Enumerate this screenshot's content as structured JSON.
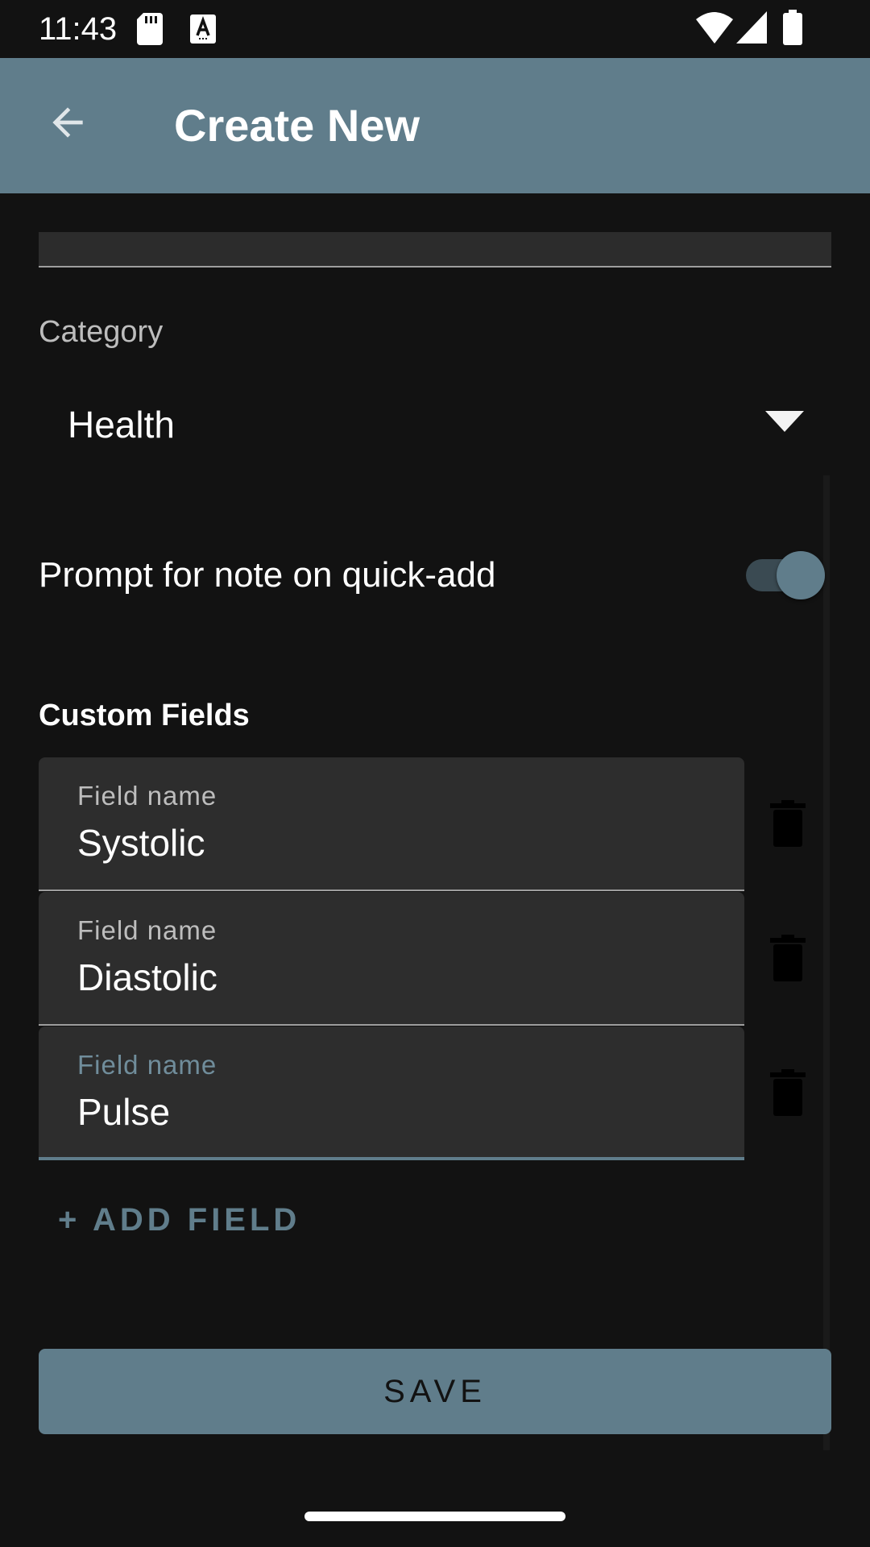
{
  "status_bar": {
    "time": "11:43",
    "icons": [
      "sd-card-icon",
      "a-keyboard-icon",
      "wifi-icon",
      "signal-icon",
      "battery-icon"
    ]
  },
  "app_bar": {
    "title": "Create New",
    "back_icon": "arrow-back-icon"
  },
  "form": {
    "category_label": "Category",
    "category_value": "Health",
    "prompt_label": "Prompt for note on quick-add",
    "prompt_enabled": true,
    "custom_fields_title": "Custom Fields",
    "fields": [
      {
        "label": "Field name",
        "value": "Systolic"
      },
      {
        "label": "Field name",
        "value": "Diastolic"
      },
      {
        "label": "Field name",
        "value": "Pulse"
      }
    ],
    "add_field_label": "+ ADD FIELD",
    "save_label": "SAVE"
  },
  "colors": {
    "accent": "#607d8b",
    "background": "#121212",
    "field_background": "#2d2d2d"
  }
}
